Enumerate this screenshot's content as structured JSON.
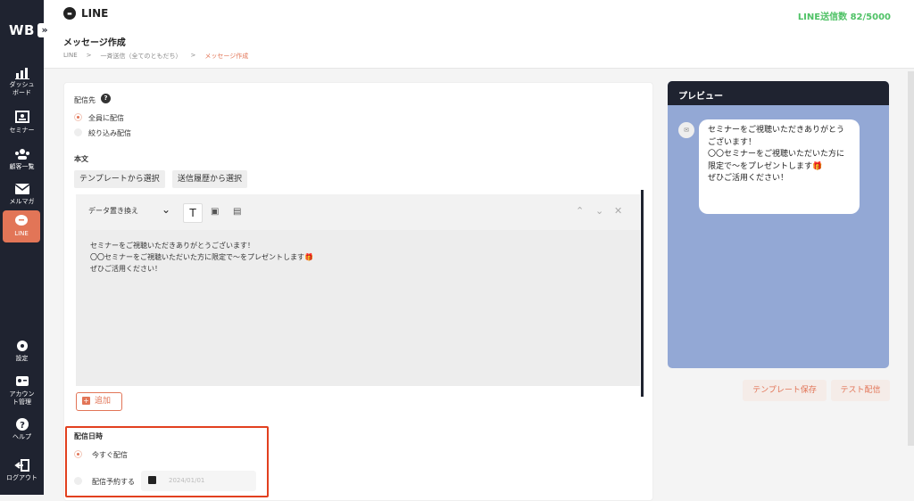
{
  "sidebar": {
    "logo": "WB",
    "expand": "»",
    "items": [
      {
        "label": "ダッシュ\nボード",
        "icon": "chart-icon"
      },
      {
        "label": "セミナー",
        "icon": "seminar-icon"
      },
      {
        "label": "顧客一覧",
        "icon": "users-icon"
      },
      {
        "label": "メルマガ",
        "icon": "mail-icon"
      },
      {
        "label": "LINE",
        "icon": "line-icon"
      },
      {
        "label": "設定",
        "icon": "gear-icon"
      },
      {
        "label": "アカウン\nト管理",
        "icon": "account-icon"
      },
      {
        "label": "ヘルプ",
        "icon": "help-icon"
      },
      {
        "label": "ログアウト",
        "icon": "logout-icon"
      }
    ]
  },
  "header": {
    "brand": "LINE",
    "quota": "LINE送信数 82/5000",
    "page_title": "メッセージ作成",
    "breadcrumb": [
      "LINE",
      ">",
      "一斉送信（全てのともだち）",
      ">",
      "メッセージ作成"
    ]
  },
  "form": {
    "recipient_label": "配信先",
    "recipient_options": [
      "全員に配信",
      "絞り込み配信"
    ],
    "body_label": "本文",
    "template_button": "テンプレートから選択",
    "history_button": "送信履歴から選択",
    "replace_data": "データ置き換え",
    "body_lines": [
      "セミナーをご視聴いただきありがとうございます！",
      "〇〇セミナーをご視聴いただいた方に限定で〜をプレゼントします🎁",
      "ぜひご活用ください！"
    ],
    "add_button": "追加",
    "schedule_label": "配信日時",
    "schedule_options": [
      "今すぐ配信",
      "配信予約する"
    ],
    "date_placeholder": "2024/01/01"
  },
  "preview": {
    "title": "プレビュー",
    "message": "セミナーをご視聴いただきありがとうございます！\n〇〇セミナーをご視聴いただいた方に限定で〜をプレゼントします🎁\nぜひご活用ください！",
    "save_template": "テンプレート保存",
    "test_send": "テスト配信"
  },
  "colors": {
    "accent": "#e27557",
    "sidebar": "#1f2330",
    "quota": "#4fc266",
    "highlight": "#e2401f",
    "preview_bg": "#93a8d5"
  }
}
